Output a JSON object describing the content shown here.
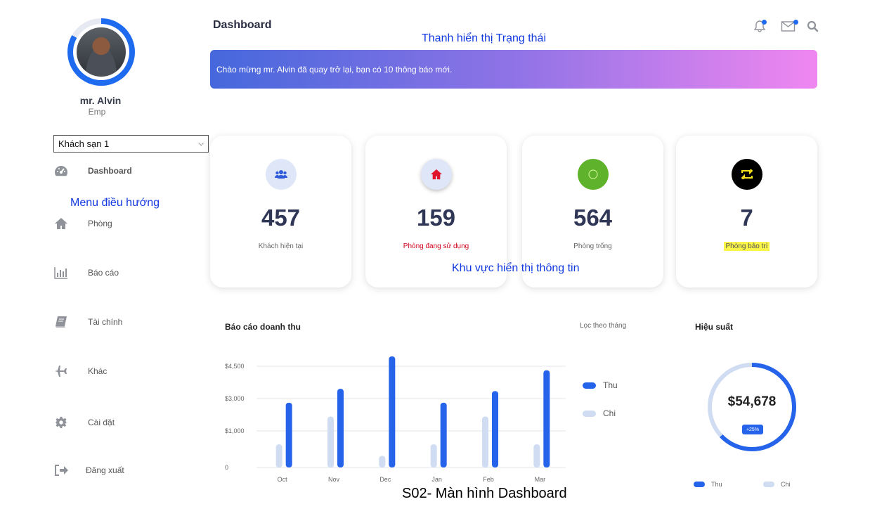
{
  "user": {
    "name": "mr. Alvin",
    "role": "Emp"
  },
  "hotel_select": {
    "value": "Khách sạn 1"
  },
  "menu": [
    {
      "key": "dashboard",
      "label": "Dashboard",
      "icon": "dashboard-gauge-icon",
      "active": true
    },
    {
      "key": "phong",
      "label": "Phòng",
      "icon": "home-icon"
    },
    {
      "key": "baocao",
      "label": "Báo cáo",
      "icon": "bar-chart-icon"
    },
    {
      "key": "taichinh",
      "label": "Tài chính",
      "icon": "book-icon"
    },
    {
      "key": "khac",
      "label": "Khác",
      "icon": "plane-icon"
    },
    {
      "key": "caidat",
      "label": "Cài đặt",
      "icon": "gear-icon"
    },
    {
      "key": "dangxuat",
      "label": "Đăng xuất",
      "icon": "sign-out-icon"
    }
  ],
  "annotations": {
    "status_bar": "Thanh hiển thị Trạng thái",
    "menu": "Menu điều hướng",
    "info_area": "Khu vực hiển thị thông tin",
    "caption": "S02- Màn hình Dashboard"
  },
  "header": {
    "title": "Dashboard",
    "banner_text": "Chào mừng mr. Alvin đã quay trở lại, bạn có 10 thông báo mới.",
    "icons": [
      "bell-icon",
      "mail-icon",
      "search-icon"
    ]
  },
  "stats": [
    {
      "value": "457",
      "label": "Khách hiện tại",
      "icon": "users-icon",
      "icon_bg": "#dfe6f7",
      "icon_color": "#2f5bd8",
      "label_color": "#666666"
    },
    {
      "value": "159",
      "label": "Phòng đang sử dụng",
      "icon": "home-icon",
      "icon_bg": "#dfe6f7",
      "icon_color": "#e0112b",
      "label_color": "#d0021b"
    },
    {
      "value": "564",
      "label": "Phòng trống",
      "icon": "circle-icon",
      "icon_bg": "#5fb22c",
      "icon_color": "#c8f08a",
      "label_color": "#666666"
    },
    {
      "value": "7",
      "label": "Phòng bảo trì",
      "icon": "retweet-icon",
      "icon_bg": "#000000",
      "icon_color": "#f5e11a",
      "label_color": "#555555",
      "label_highlight": "#fbf54a"
    }
  ],
  "revenue": {
    "title": "Báo cáo doanh thu",
    "filter_label": "Lọc theo tháng",
    "legend": [
      {
        "name": "Thu",
        "color": "#2563eb"
      },
      {
        "name": "Chi",
        "color": "#cfdcf2"
      }
    ]
  },
  "performance": {
    "title": "Hiệu suất",
    "value": "$54,678",
    "badge": "+25%",
    "ring_fraction": 0.63,
    "legend": [
      {
        "name": "Thu",
        "color": "#2563eb"
      },
      {
        "name": "Chi",
        "color": "#cfdcf2"
      }
    ]
  },
  "chart_data": {
    "type": "bar",
    "categories": [
      "Oct",
      "Nov",
      "Dec",
      "Jan",
      "Feb",
      "Mar"
    ],
    "series": [
      {
        "name": "Thu",
        "values": [
          2800,
          3400,
          4800,
          2800,
          3300,
          4200
        ]
      },
      {
        "name": "Chi",
        "values": [
          1000,
          2200,
          500,
          1000,
          2200,
          1000
        ]
      }
    ],
    "yticks": [
      "$4,500",
      "$3,000",
      "$1,000",
      "0"
    ],
    "ytick_values": [
      4500,
      3000,
      1500,
      0
    ],
    "ylim": [
      0,
      4800
    ],
    "grid": true
  }
}
